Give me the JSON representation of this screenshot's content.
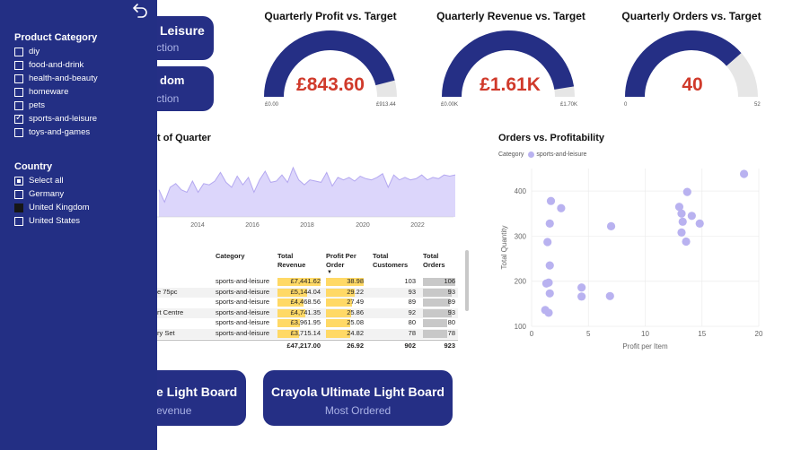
{
  "cards": {
    "top1": {
      "title": "Leisure",
      "sub": "ction"
    },
    "top2": {
      "title": "dom",
      "sub": "ction"
    },
    "bottom1": {
      "title": "e Light Board",
      "sub": "evenue"
    },
    "bottom2": {
      "title": "Crayola Ultimate Light Board",
      "sub": "Most Ordered"
    }
  },
  "gauges": [
    {
      "title": "Quarterly Profit vs. Target",
      "value": "£843.60",
      "min": "£0.00",
      "max": "£913.44",
      "fraction": 0.92
    },
    {
      "title": "Quarterly Revenue vs. Target",
      "value": "£1.61K",
      "min": "£0.00K",
      "max": "£1.70K",
      "fraction": 0.95
    },
    {
      "title": "Quarterly Orders vs. Target",
      "value": "40",
      "min": "0",
      "max": "52",
      "fraction": 0.77
    }
  ],
  "colors": {
    "navy": "#252f85",
    "gauge_track": "#e6e6e6",
    "value_red": "#d03a2b",
    "scatter": "#b9b2f0",
    "area": "#dcd6fb",
    "area_line": "#b4a8f0",
    "bar_yellow": "#ffd966",
    "bar_gray": "#c8c8c8"
  },
  "line_chart": {
    "title": "t of Quarter",
    "chart_data": {
      "type": "area",
      "x_ticks": [
        "2014",
        "2016",
        "2018",
        "2020",
        "2022"
      ],
      "values": [
        22,
        12,
        24,
        27,
        22,
        20,
        29,
        20,
        27,
        26,
        29,
        36,
        28,
        24,
        33,
        26,
        32,
        20,
        30,
        37,
        28,
        29,
        34,
        28,
        40,
        30,
        26,
        30,
        29,
        28,
        36,
        25,
        32,
        30,
        32,
        29,
        33,
        31,
        30,
        32,
        35,
        24,
        34,
        30,
        32,
        30,
        31,
        34,
        30,
        32,
        31,
        34,
        33,
        34
      ]
    }
  },
  "table": {
    "headers": {
      "category": "Category",
      "revenue": "Total Revenue",
      "ppo": "Profit Per Order",
      "customers": "Total Customers",
      "orders": "Total Orders"
    },
    "rows": [
      {
        "name": "",
        "category": "sports-and-leisure",
        "revenue": "£7,441.62",
        "ppo": "38.98",
        "customers": "103",
        "orders": "106"
      },
      {
        "name": "e 75pc",
        "category": "sports-and-leisure",
        "revenue": "£5,144.04",
        "ppo": "29.22",
        "customers": "93",
        "orders": "93"
      },
      {
        "name": "",
        "category": "sports-and-leisure",
        "revenue": "£4,468.56",
        "ppo": "27.49",
        "customers": "89",
        "orders": "89"
      },
      {
        "name": "rt Centre",
        "category": "sports-and-leisure",
        "revenue": "£4,741.35",
        "ppo": "25.86",
        "customers": "92",
        "orders": "93"
      },
      {
        "name": "",
        "category": "sports-and-leisure",
        "revenue": "£3,961.95",
        "ppo": "25.08",
        "customers": "80",
        "orders": "80"
      },
      {
        "name": "ry Set",
        "category": "sports-and-leisure",
        "revenue": "£3,715.14",
        "ppo": "24.82",
        "customers": "78",
        "orders": "78"
      }
    ],
    "bar_fractions": {
      "revenue": [
        1.0,
        0.69,
        0.6,
        0.64,
        0.53,
        0.5
      ],
      "ppo": [
        1.0,
        0.75,
        0.7,
        0.66,
        0.64,
        0.64
      ],
      "orders": [
        1.0,
        0.88,
        0.84,
        0.88,
        0.75,
        0.74
      ]
    },
    "totals": {
      "revenue": "£47,217.00",
      "ppo": "26.92",
      "customers": "902",
      "orders": "923"
    }
  },
  "scatter": {
    "title": "Orders vs. Profitability",
    "legend_label": "Category",
    "legend_item": "sports-and-leisure",
    "chart_data": {
      "type": "scatter",
      "xlabel": "Profit per Item",
      "ylabel": "Total Quantity",
      "xlim": [
        0,
        20
      ],
      "ylim": [
        100,
        450
      ],
      "x_ticks": [
        0,
        5,
        10,
        15,
        20
      ],
      "y_ticks": [
        100,
        200,
        300,
        400
      ],
      "series": [
        {
          "name": "sports-and-leisure",
          "points": [
            [
              18.7,
              438
            ],
            [
              13.7,
              398
            ],
            [
              13.0,
              365
            ],
            [
              14.1,
              345
            ],
            [
              13.2,
              350
            ],
            [
              13.3,
              332
            ],
            [
              14.8,
              328
            ],
            [
              13.2,
              308
            ],
            [
              13.6,
              288
            ],
            [
              1.7,
              378
            ],
            [
              2.6,
              362
            ],
            [
              1.6,
              328
            ],
            [
              7.0,
              322
            ],
            [
              1.4,
              287
            ],
            [
              1.6,
              235
            ],
            [
              1.5,
              197
            ],
            [
              1.3,
              195
            ],
            [
              4.4,
              186
            ],
            [
              1.6,
              173
            ],
            [
              4.4,
              166
            ],
            [
              6.9,
              167
            ],
            [
              1.2,
              136
            ],
            [
              1.5,
              130
            ]
          ]
        }
      ]
    }
  },
  "slicer": {
    "category_title": "Product Category",
    "categories": [
      {
        "label": "diy",
        "state": "unchecked"
      },
      {
        "label": "food-and-drink",
        "state": "unchecked"
      },
      {
        "label": "health-and-beauty",
        "state": "unchecked"
      },
      {
        "label": "homeware",
        "state": "unchecked"
      },
      {
        "label": "pets",
        "state": "unchecked"
      },
      {
        "label": "sports-and-leisure",
        "state": "checked"
      },
      {
        "label": "toys-and-games",
        "state": "unchecked"
      }
    ],
    "country_title": "Country",
    "countries": [
      {
        "label": "Select all",
        "state": "partial"
      },
      {
        "label": "Germany",
        "state": "unchecked"
      },
      {
        "label": "United Kingdom",
        "state": "filled"
      },
      {
        "label": "United States",
        "state": "unchecked"
      }
    ]
  }
}
